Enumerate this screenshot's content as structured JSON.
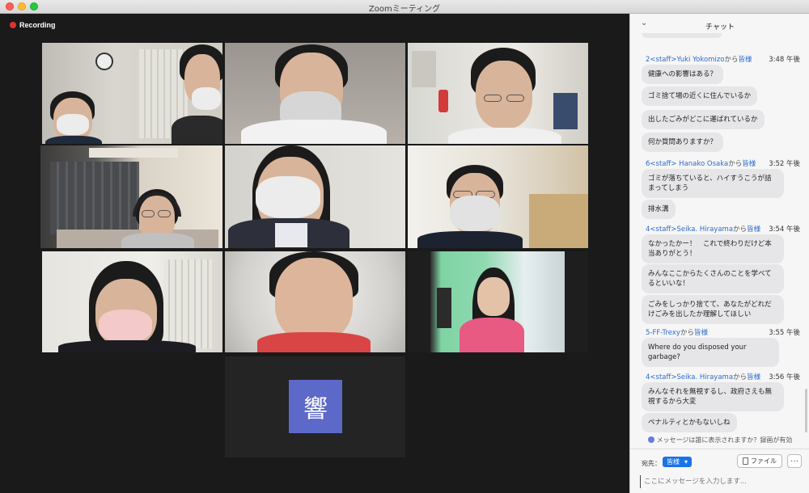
{
  "window": {
    "title": "Zoomミーティング"
  },
  "recording": {
    "label": "Recording",
    "color": "#e03131"
  },
  "avatar_tile": {
    "initial": "響",
    "color": "#5d69c9"
  },
  "chat": {
    "title": "チャット",
    "messages": [
      {
        "sender": "2<staff>Yuki Yokomizo",
        "to": "から",
        "target": "皆様",
        "time": "3:48 午後",
        "lines": [
          "健康への影響はある？",
          "ゴミ捨て場の近くに住んでいるか",
          "出したごみがどこに運ばれているか",
          "何か質問ありますか？"
        ]
      },
      {
        "sender": "6<staff> Hanako Osaka",
        "to": "から",
        "target": "皆様",
        "time": "3:52 午後",
        "lines": [
          "ゴミが落ちていると、ハイすうこうが詰まってしまう",
          "排水溝"
        ]
      },
      {
        "sender": "4<staff>Seika. Hirayama",
        "to": "から",
        "target": "皆様",
        "time": "3:54 午後",
        "lines": [
          "なかったかー！　これで終わりだけど本当ありがとう！",
          "みんなここからたくさんのことを学べてるといいな！",
          "ごみをしっかり捨てて、あなたがどれだけごみを出したか理解してほしい"
        ]
      },
      {
        "sender": "5-FF-Trexy",
        "to": "から",
        "target": "皆様",
        "time": "3:55 午後",
        "lines": [
          "Where do you disposed your garbage?"
        ]
      },
      {
        "sender": "4<staff>Seika. Hirayama",
        "to": "から",
        "target": "皆様",
        "time": "3:56 午後",
        "lines": [
          "みんなそれを無視するし、政府さえも無視するから大変",
          "ペナルティとかもないしね"
        ]
      }
    ],
    "notice": "メッセージは誰に表示されますか？録画が有効",
    "to_label": "宛先：",
    "to_value": "皆様",
    "file_label": "ファイル",
    "more_label": "···",
    "input_placeholder": "ここにメッセージを入力します..."
  },
  "colors": {
    "accent": "#1a73e8",
    "active_speaker": "#c8e04a",
    "sender_link": "#2d6ccf"
  }
}
